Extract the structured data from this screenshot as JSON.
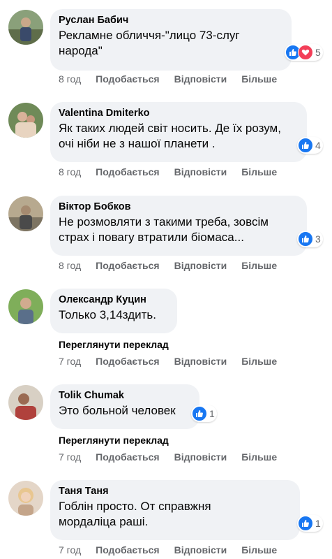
{
  "actions": {
    "like": "Подобається",
    "reply": "Відповісти",
    "more": "Більше"
  },
  "translate_label": "Переглянути переклад",
  "comments": [
    {
      "author": "Руслан Бабич",
      "text": "Рекламне обличчя-\"лицо 73-слуг народа\"",
      "time": "8 год",
      "reactions": [
        "like",
        "love"
      ],
      "reaction_count": "5"
    },
    {
      "author": "Valentina Dmiterko",
      "text": "Як таких людей світ носить. Де їх розум, очі ніби не з нашої планети .",
      "time": "8 год",
      "reactions": [
        "like"
      ],
      "reaction_count": "4"
    },
    {
      "author": "Віктор Бобков",
      "text": "Не розмовляти з такими треба, зовсім страх і повагу втратили біомаса...",
      "time": "8 год",
      "reactions": [
        "like"
      ],
      "reaction_count": "3"
    },
    {
      "author": "Олександр Куцин",
      "text": "Только 3,14здить.",
      "time": "7 год",
      "reactions": [],
      "reaction_count": ""
    },
    {
      "author": "Tolik Chumak",
      "text": "Это больной человек",
      "time": "7 год",
      "reactions": [
        "like"
      ],
      "reaction_count": "1"
    },
    {
      "author": "Таня Таня",
      "text": "Гоблін просто. От справжня мордаліца раші.",
      "time": "7 год",
      "reactions": [
        "like"
      ],
      "reaction_count": "1"
    }
  ],
  "colors": {
    "bubble": "#f0f2f5",
    "like": "#1877f2",
    "love": "#f33e58",
    "meta": "#65676b"
  }
}
